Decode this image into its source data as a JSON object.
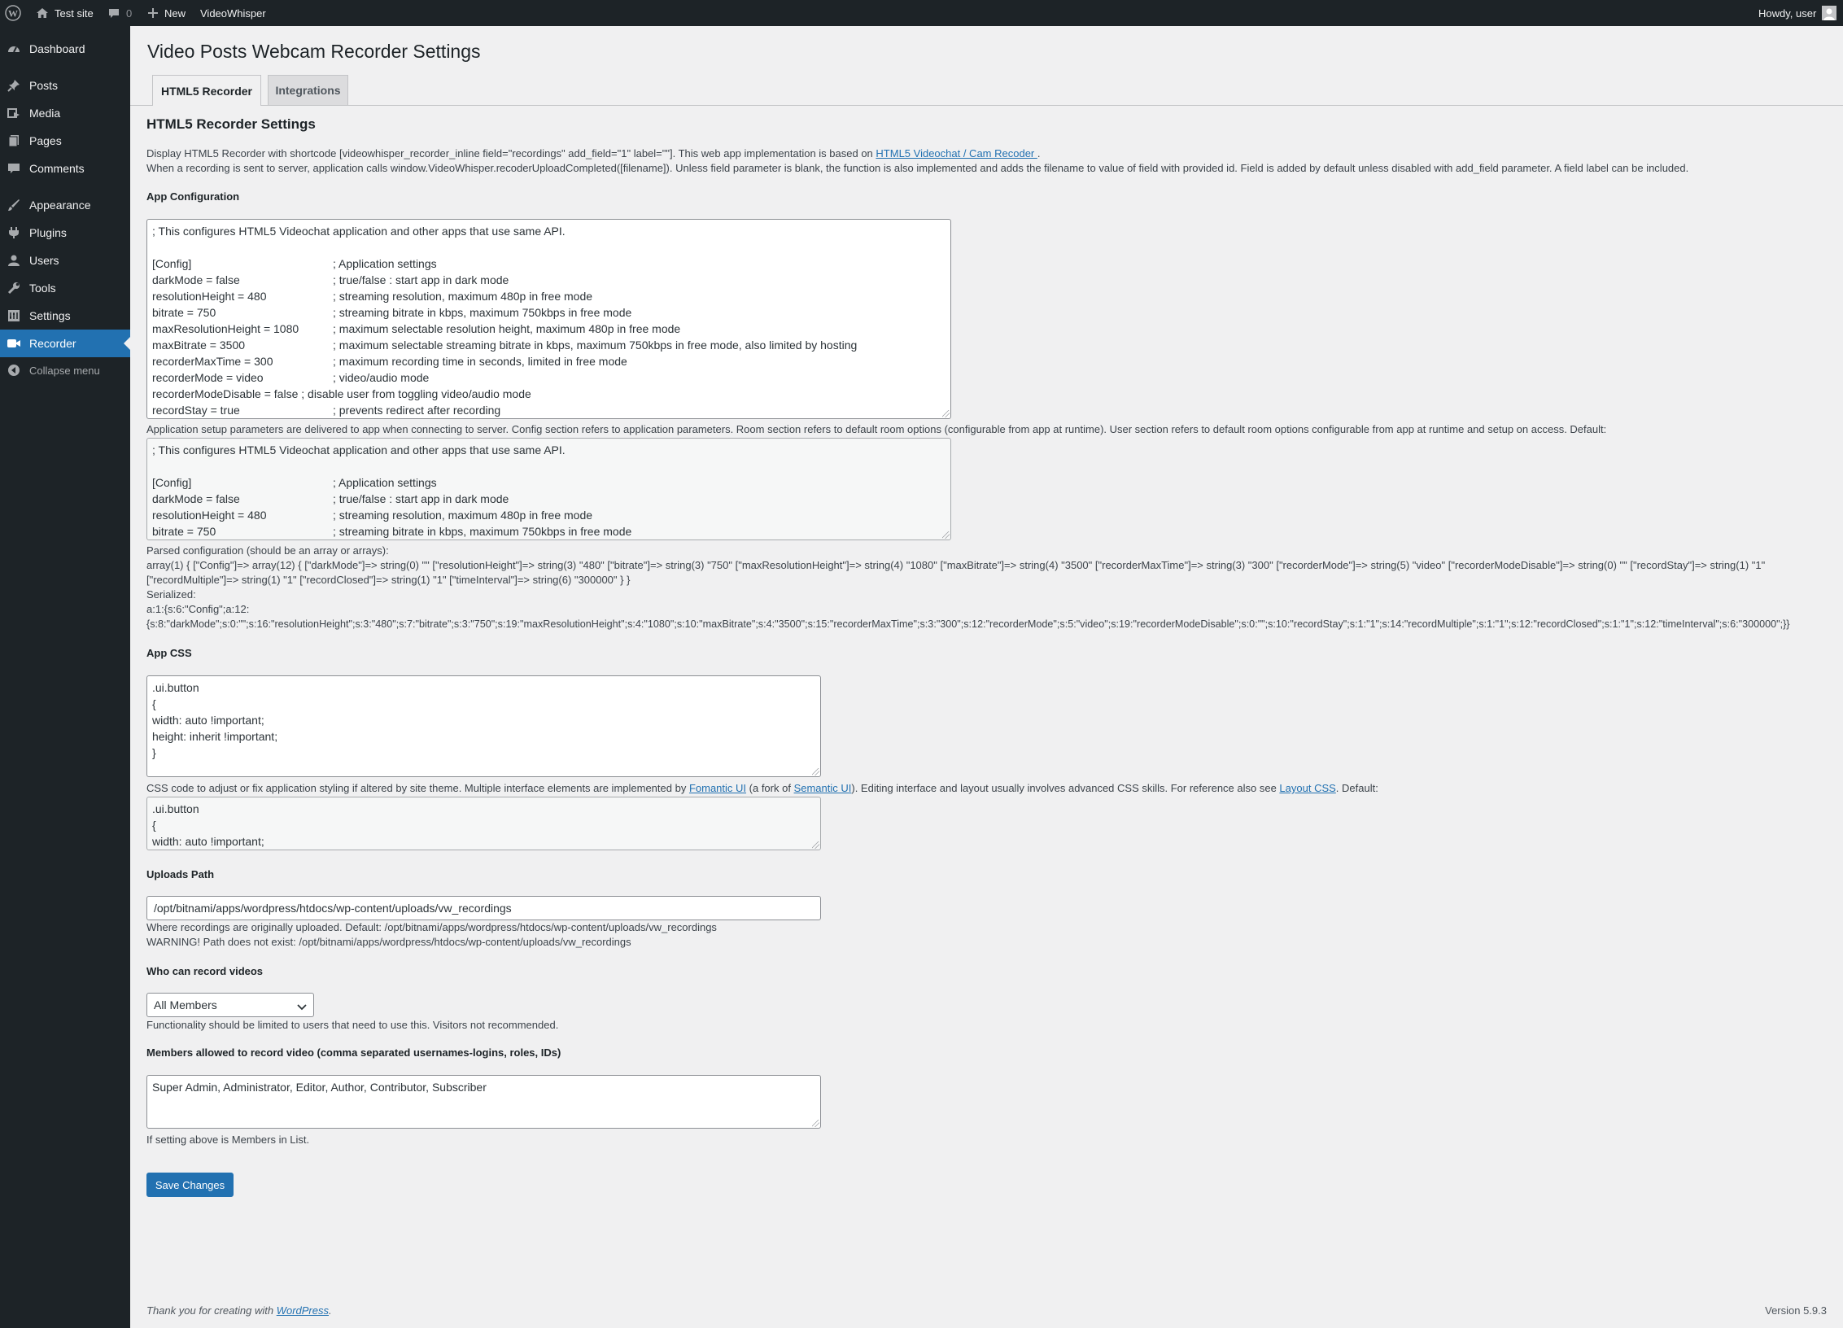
{
  "adminbar": {
    "site_name": "Test site",
    "comments_count": "0",
    "new_label": "New",
    "plugin_link": "VideoWhisper",
    "howdy": "Howdy, user"
  },
  "sidebar": {
    "items": [
      {
        "label": "Dashboard",
        "icon": "dashboard-icon"
      },
      {
        "label": "Posts",
        "icon": "pushpin-icon"
      },
      {
        "label": "Media",
        "icon": "media-icon"
      },
      {
        "label": "Pages",
        "icon": "pages-icon"
      },
      {
        "label": "Comments",
        "icon": "comment-icon"
      },
      {
        "label": "Appearance",
        "icon": "paintbrush-icon"
      },
      {
        "label": "Plugins",
        "icon": "plugin-icon"
      },
      {
        "label": "Users",
        "icon": "users-icon"
      },
      {
        "label": "Tools",
        "icon": "wrench-icon"
      },
      {
        "label": "Settings",
        "icon": "settings-icon"
      },
      {
        "label": "Recorder",
        "icon": "video-camera-icon"
      }
    ],
    "collapse_label": "Collapse menu"
  },
  "page": {
    "title": "Video Posts Webcam Recorder Settings",
    "tabs": [
      "HTML5 Recorder",
      "Integrations"
    ],
    "section_title": "HTML5 Recorder Settings",
    "intro_line1_a": "Display HTML5 Recorder with shortcode [videowhisper_recorder_inline field=\"recordings\" add_field=\"1\" label=\"\"]. This web app implementation is based on ",
    "intro_link": "HTML5 Videochat / Cam Recoder ",
    "intro_line1_b": ".",
    "intro_line2": "When a recording is sent to server, application calls window.VideoWhisper.recoderUploadCompleted([filename]). Unless field parameter is blank, the function is also implemented and adds the filename to value of field with provided id. Field is added by default unless disabled with add_field parameter. A field label can be included."
  },
  "app_config": {
    "label": "App Configuration",
    "lines": [
      {
        "k": "; This configures HTML5 Videochat application and other apps that use same API.",
        "c": ""
      },
      {
        "k": "",
        "c": ""
      },
      {
        "k": "[Config]",
        "c": "; Application settings"
      },
      {
        "k": "darkMode = false",
        "c": "; true/false : start app in dark mode"
      },
      {
        "k": "resolutionHeight = 480",
        "c": "; streaming resolution, maximum 480p in free mode"
      },
      {
        "k": "bitrate = 750",
        "c": "; streaming bitrate in kbps, maximum 750kbps in free mode"
      },
      {
        "k": "maxResolutionHeight = 1080",
        "c": "; maximum selectable resolution height, maximum 480p in free mode"
      },
      {
        "k": "maxBitrate = 3500",
        "c": "; maximum selectable streaming bitrate in kbps, maximum 750kbps in free mode, also limited by hosting"
      },
      {
        "k": "recorderMaxTime = 300",
        "c": "; maximum recording time in seconds, limited in free mode"
      },
      {
        "k": "recorderMode = video",
        "c": "; video/audio mode"
      },
      {
        "k": "recorderModeDisable      = false             ; disable user from toggling video/audio mode",
        "c": ""
      },
      {
        "k": "recordStay = true",
        "c": "; prevents redirect after recording"
      }
    ],
    "description": "Application setup parameters are delivered to app when connecting to server. Config section refers to application parameters. Room section refers to default room options (configurable from app at runtime). User section refers to default room options configurable from app at runtime and setup on access. Default:",
    "default_lines": [
      {
        "k": "; This configures HTML5 Videochat application and other apps that use same API.",
        "c": ""
      },
      {
        "k": "",
        "c": ""
      },
      {
        "k": "[Config]",
        "c": "; Application settings"
      },
      {
        "k": "darkMode = false",
        "c": "; true/false : start app in dark mode"
      },
      {
        "k": "resolutionHeight = 480",
        "c": "; streaming resolution, maximum 480p in free mode"
      },
      {
        "k": "bitrate = 750",
        "c": "; streaming bitrate in kbps, maximum 750kbps in free mode"
      }
    ],
    "parsed_label": "Parsed configuration (should be an array or arrays):",
    "parsed_line1": "array(1) { [\"Config\"]=> array(12) { [\"darkMode\"]=> string(0) \"\" [\"resolutionHeight\"]=> string(3) \"480\" [\"bitrate\"]=> string(3) \"750\" [\"maxResolutionHeight\"]=> string(4) \"1080\" [\"maxBitrate\"]=> string(4) \"3500\" [\"recorderMaxTime\"]=> string(3) \"300\" [\"recorderMode\"]=> string(5) \"video\" [\"recorderModeDisable\"]=> string(0) \"\" [\"recordStay\"]=> string(1) \"1\"",
    "parsed_line2": "[\"recordMultiple\"]=> string(1) \"1\" [\"recordClosed\"]=> string(1) \"1\" [\"timeInterval\"]=> string(6) \"300000\" } }",
    "serialized_label": "Serialized:",
    "serialized_line1": "a:1:{s:6:\"Config\";a:12:",
    "serialized_line2": "{s:8:\"darkMode\";s:0:\"\";s:16:\"resolutionHeight\";s:3:\"480\";s:7:\"bitrate\";s:3:\"750\";s:19:\"maxResolutionHeight\";s:4:\"1080\";s:10:\"maxBitrate\";s:4:\"3500\";s:15:\"recorderMaxTime\";s:3:\"300\";s:12:\"recorderMode\";s:5:\"video\";s:19:\"recorderModeDisable\";s:0:\"\";s:10:\"recordStay\";s:1:\"1\";s:14:\"recordMultiple\";s:1:\"1\";s:12:\"recordClosed\";s:1:\"1\";s:12:\"timeInterval\";s:6:\"300000\";}}"
  },
  "app_css": {
    "label": "App CSS",
    "lines": [
      ".ui.button",
      "{",
      "width: auto !important;",
      "height: inherit !important;",
      "}"
    ],
    "desc_a": "CSS code to adjust or fix application styling if altered by site theme. Multiple interface elements are implemented by ",
    "desc_link1": "Fomantic UI",
    "desc_b": " (a fork of ",
    "desc_link2": "Semantic UI",
    "desc_c": "). Editing interface and layout usually involves advanced CSS skills. For reference also see ",
    "desc_link3": "Layout CSS",
    "desc_d": ". Default:",
    "default_lines": [
      ".ui.button",
      "{",
      "width: auto !important;"
    ]
  },
  "uploads": {
    "label": "Uploads Path",
    "value": "/opt/bitnami/apps/wordpress/htdocs/wp-content/uploads/vw_recordings",
    "help": "Where recordings are originally uploaded. Default: /opt/bitnami/apps/wordpress/htdocs/wp-content/uploads/vw_recordings",
    "warning": "WARNING! Path does not exist: /opt/bitnami/apps/wordpress/htdocs/wp-content/uploads/vw_recordings"
  },
  "who": {
    "label": "Who can record videos",
    "selected": "All Members",
    "help": "Functionality should be limited to users that need to use this. Visitors not recommended."
  },
  "members": {
    "label": "Members allowed to record video (comma separated usernames-logins, roles, IDs)",
    "value": "Super Admin, Administrator, Editor, Author, Contributor, Subscriber",
    "help": "If setting above is Members in List."
  },
  "save_label": "Save Changes",
  "footer": {
    "thanks": "Thank you for creating with ",
    "wp_link": "WordPress",
    "period": ".",
    "version": "Version 5.9.3"
  }
}
